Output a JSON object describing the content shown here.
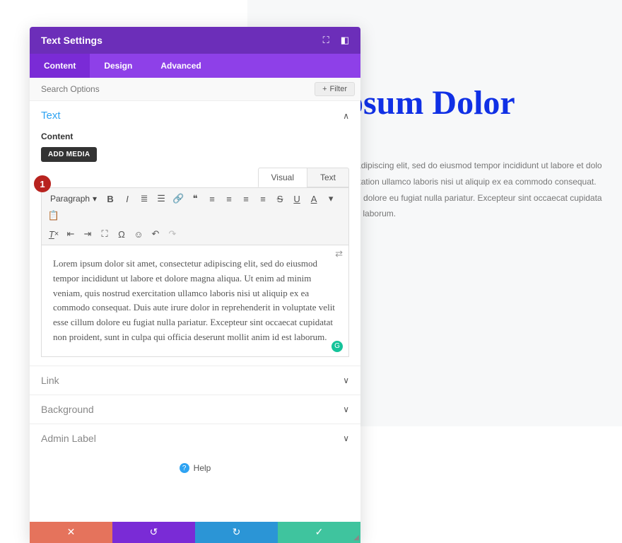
{
  "bg": {
    "title": "um Ipsum Dolor",
    "line1": "sit amet, consectetur adipiscing elit, sed do eiusmod tempor incididunt ut labore et dolo",
    "line2": "m, quis nostrud exercitation ullamco laboris nisi ut aliquip ex ea commodo consequat.",
    "line3": "uptate velit esse cillum dolore eu fugiat nulla pariatur. Excepteur sint occaecat cupidata",
    "line4": "erunt mollit anim id est laborum."
  },
  "panel": {
    "title": "Text Settings"
  },
  "tabs": {
    "content": "Content",
    "design": "Design",
    "advanced": "Advanced"
  },
  "search": {
    "placeholder": "Search Options",
    "filter": "Filter"
  },
  "sections": {
    "text": "Text",
    "link": "Link",
    "background": "Background",
    "admin_label": "Admin Label"
  },
  "editor": {
    "content_label": "Content",
    "add_media": "ADD MEDIA",
    "tab_visual": "Visual",
    "tab_text": "Text",
    "format": "Paragraph",
    "body": "Lorem ipsum dolor sit amet, consectetur adipiscing elit, sed do eiusmod tempor incididunt ut labore et dolore magna aliqua. Ut enim ad minim veniam, quis nostrud exercitation ullamco laboris nisi ut aliquip ex ea commodo consequat. Duis aute irure dolor in reprehenderit in voluptate velit esse cillum dolore eu fugiat nulla pariatur. Excepteur sint occaecat cupidatat non proident, sunt in culpa qui officia deserunt mollit anim id est laborum."
  },
  "help": {
    "label": "Help"
  },
  "callout": {
    "num": "1"
  }
}
